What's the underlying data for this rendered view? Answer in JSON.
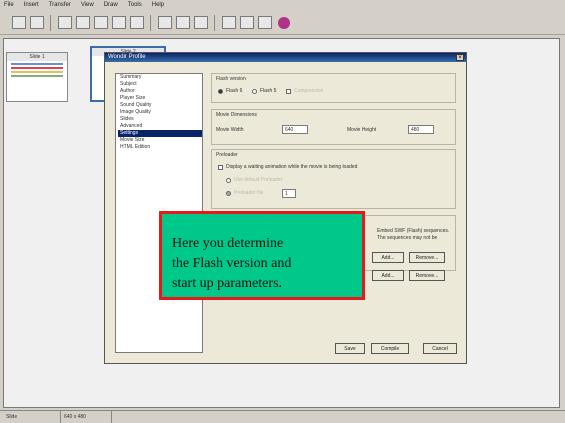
{
  "menu": [
    "File",
    "Insert",
    "Transfer",
    "View",
    "Draw",
    "Tools",
    "Help"
  ],
  "toolbar_icons": [
    "new-icon",
    "open-icon",
    "cut-icon",
    "copy-icon",
    "paste-icon",
    "undo-icon",
    "redo-icon",
    "slide-icon",
    "image-icon",
    "media-icon",
    "link-icon",
    "preview-icon",
    "publish-icon",
    "flash-icon"
  ],
  "slides": [
    {
      "title": "Slide 1"
    },
    {
      "title": "Slide 2"
    }
  ],
  "dialog": {
    "title": "Wondir Profile",
    "categories": [
      "Summary",
      "Subject",
      "Author",
      "Player Size",
      "Sound Quality",
      "Image Quality",
      "Slides",
      "Advanced",
      "Settings",
      "Movie Size",
      "HTML Edition"
    ],
    "selected_index": 8,
    "flash_version": {
      "title": "Flash version",
      "options": [
        "Flash 6",
        "Flash 5"
      ],
      "checkbox": "Compression"
    },
    "movie_dimensions": {
      "title": "Movie Dimensions",
      "width_label": "Movie Width",
      "width_value": "640",
      "height_label": "Movie Height",
      "height_value": "480"
    },
    "preloader": {
      "title": "Preloader",
      "checkbox_label": "Display a waiting animation while the movie is being loaded",
      "suboption1": "Use default Preloader",
      "suboption2": "Preloader file",
      "spin_value": "1"
    },
    "import_text": [
      "Embed SWF (Flash) sequences.",
      "The sequences may not be"
    ],
    "add_label": "Add...",
    "remove_label": "Remove...",
    "save_label": "Save",
    "compile_label": "Compile",
    "cancel_label": "Cancel"
  },
  "callout": {
    "line1": "Here you determine",
    "line2": "the Flash version and",
    "line3": "start up parameters."
  },
  "status": {
    "left": "Slide",
    "zoom": "640 x 480"
  },
  "colors": {
    "callout_fill": "#00c88a",
    "callout_border": "#e51b1b",
    "title_bar": "#0a246a",
    "selection": "#0a246a"
  }
}
